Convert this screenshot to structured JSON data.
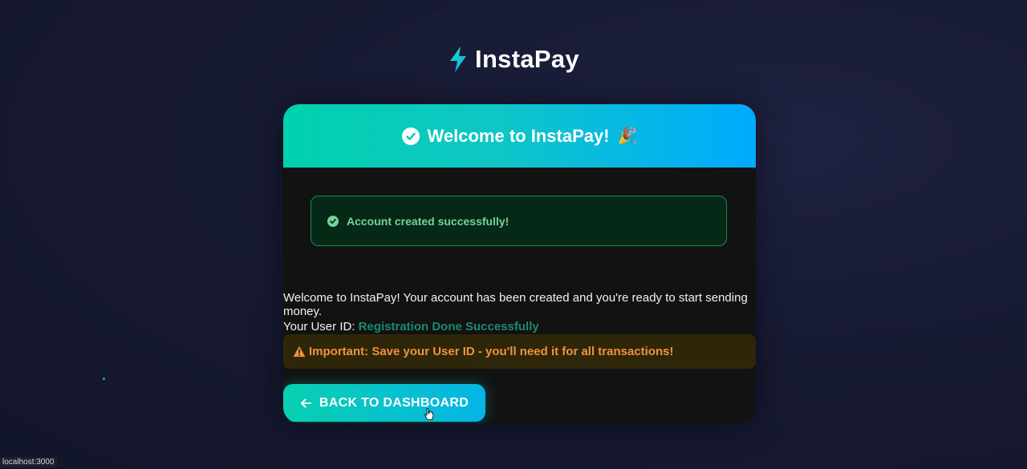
{
  "brand": {
    "name": "InstaPay",
    "icon": "lightning-bolt-icon"
  },
  "card": {
    "header_title": "Welcome to InstaPay!",
    "header_emoji": "🎉",
    "success_message": "Account created successfully!",
    "welcome_text": "Welcome to InstaPay! Your account has been created and you're ready to start sending money.",
    "user_id_label": "Your User ID:",
    "user_id_value": "Registration Done Successfully",
    "warning_text": "Important: Save your User ID - you'll need it for all transactions!",
    "back_button_label": "BACK TO DASHBOARD"
  },
  "status_bar": {
    "url": "localhost:3000"
  },
  "colors": {
    "accent_teal": "#00d1ad",
    "accent_blue": "#00aaff",
    "success_green": "#74d39a",
    "warning_orange": "#f0923e"
  }
}
